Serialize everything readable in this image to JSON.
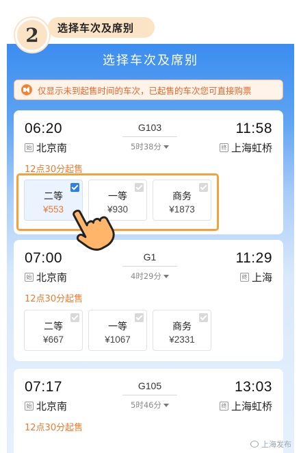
{
  "step": {
    "number": "2",
    "title": "选择车次及席别"
  },
  "page": {
    "title": "选择车次及席别"
  },
  "notice": {
    "text": "仅显示未到起售时间的车次，已起售的车次您可直接购票"
  },
  "trains": [
    {
      "depart_time": "06:20",
      "arrive_time": "11:58",
      "train_no": "G103",
      "duration": "5时38分",
      "from_tag": "始",
      "from_station": "北京南",
      "to_tag": "终",
      "to_station": "上海虹桥",
      "sale_time": "12点30分起售",
      "seats": [
        {
          "name": "二等",
          "price": "¥553",
          "selected": true
        },
        {
          "name": "一等",
          "price": "¥930",
          "selected": false
        },
        {
          "name": "商务",
          "price": "¥1873",
          "selected": false
        }
      ]
    },
    {
      "depart_time": "07:00",
      "arrive_time": "11:29",
      "train_no": "G1",
      "duration": "4时29分",
      "from_tag": "始",
      "from_station": "北京南",
      "to_tag": "终",
      "to_station": "上海",
      "sale_time": "12点30分起售",
      "seats": [
        {
          "name": "二等",
          "price": "¥667",
          "selected": false
        },
        {
          "name": "一等",
          "price": "¥1067",
          "selected": false
        },
        {
          "name": "商务",
          "price": "¥2331",
          "selected": false
        }
      ]
    },
    {
      "depart_time": "07:17",
      "arrive_time": "13:03",
      "train_no": "G105",
      "duration": "5时46分",
      "from_tag": "始",
      "from_station": "北京南",
      "to_tag": "终",
      "to_station": "上海虹桥",
      "sale_time": "12点30分起售",
      "seats": []
    }
  ],
  "watermark": {
    "text": "上海发布"
  },
  "colors": {
    "accent_blue": "#3b8df0",
    "accent_orange": "#ee7a2e",
    "highlight": "#f4a03b",
    "badge_bg": "#fbe3c6"
  }
}
